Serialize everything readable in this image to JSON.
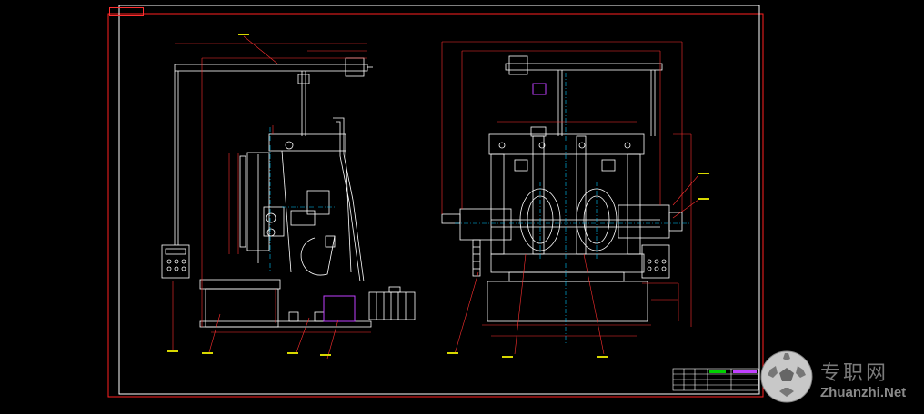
{
  "drawing": {
    "tag_text": "",
    "colors": {
      "background": "#000000",
      "outer_border": "#ff2020",
      "inner_border": "#ffffff",
      "geometry": "#ffffff",
      "dimension": "#ff3030",
      "centerline": "#00c8ff",
      "leader": "#ff2020",
      "highlight": "#c040ff",
      "yellow_note": "#d8d800",
      "green_note": "#00d000"
    }
  },
  "watermark": {
    "cn_text": "专职网",
    "en_text": "Zhuanzhi.Net",
    "icon": "soccer-ball-logo-icon"
  }
}
